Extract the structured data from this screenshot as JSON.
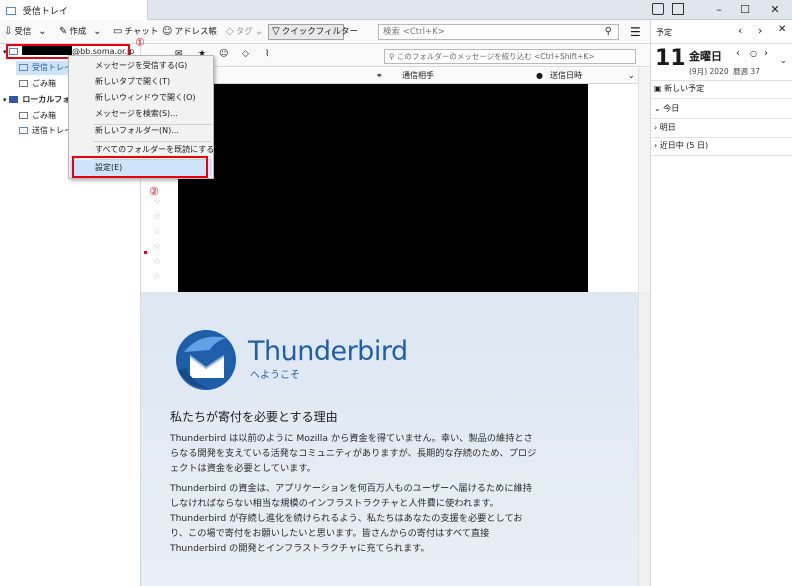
{
  "titlebar": {
    "tab_label": "受信トレイ",
    "controls": [
      "–",
      "☐",
      "✕"
    ]
  },
  "toolbar": {
    "get_label": "受信",
    "write_label": "作成",
    "chat_label": "チャット",
    "address_label": "アドレス帳",
    "tag_label": "タグ",
    "quickfilter_label": "クイックフィルター",
    "search_placeholder": "検索 <Ctrl+K>",
    "menu_icon": "☰"
  },
  "folders": {
    "account_suffix": "@bb.soma.or.jp",
    "items": [
      {
        "label": "受信トレイ"
      },
      {
        "label": "ごみ箱"
      },
      {
        "label": "ローカルフォル"
      },
      {
        "label": "ごみ箱"
      },
      {
        "label": "送信トレイ"
      }
    ]
  },
  "messagelist": {
    "quickfilter_placeholder": "このフォルダーのメッセージを絞り込む <Ctrl+Shift+K>",
    "columns": {
      "correspondent": "通信相手",
      "date": "送信日時"
    }
  },
  "context_menu": {
    "items": [
      "メッセージを受信する(G)",
      "新しいタブで開く(T)",
      "新しいウィンドウで開く(O)",
      "メッセージを検索(S)...",
      "新しいフォルダー(N)...",
      "すべてのフォルダーを既読にする",
      "設定(E)"
    ]
  },
  "annotations": {
    "marker1": "①",
    "marker2": "②"
  },
  "startpage": {
    "app_name": "Thunderbird",
    "welcome": "へようこそ",
    "heading": "私たちが寄付を必要とする理由",
    "para1": "Thunderbird は以前のように Mozilla から資金を得ていません。幸い、製品の維持とさらなる開発を支えている活発なコミュニティがありますが、長期的な存続のため、プロジェクトは資金を必要としています。",
    "para2": "Thunderbird の資金は、アプリケーションを何百万人ものユーザーへ届けるために維持しなければならない相当な規模のインフラストラクチャと人件費に使われます。Thunderbird が存続し進化を続けられるよう、私たちはあなたの支援を必要としており、この場で寄付をお願いしたいと思います。皆さんからの寄付はすべて直接 Thunderbird の開発とインフラストラクチャに充てられます。"
  },
  "calendar": {
    "pane_title": "予定",
    "day_number": "11",
    "weekday": "金曜日",
    "sub_date": "(9月) 2020",
    "week_label": "暦週 37",
    "new_event": "新しい予定",
    "sections": [
      "今日",
      "明日",
      "近日中 (5 日)"
    ]
  },
  "colors": {
    "accent_red": "#e60012",
    "thunderbird_blue": "#1f5ea8",
    "selection": "#cde4fb"
  }
}
